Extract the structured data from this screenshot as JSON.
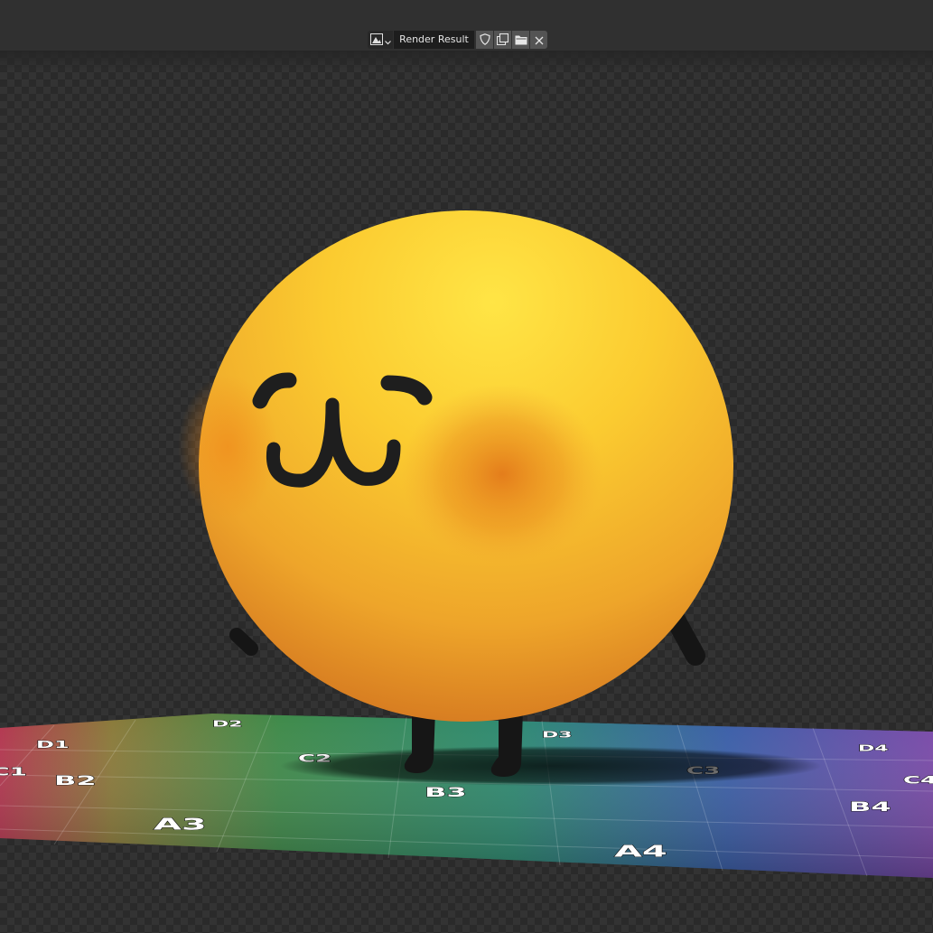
{
  "header": {
    "image_name": "Render Result",
    "icons": {
      "browse": "image-browse-icon",
      "fake_user": "shield-icon",
      "new": "duplicate-icon",
      "open": "folder-icon",
      "unlink": "close-icon"
    }
  },
  "render": {
    "subject": "yellow-ball-character",
    "floor_tile_labels": [
      {
        "text": "D1"
      },
      {
        "text": "D2"
      },
      {
        "text": "D3"
      },
      {
        "text": "D4"
      },
      {
        "text": "C1"
      },
      {
        "text": "C2"
      },
      {
        "text": "C3"
      },
      {
        "text": "C4"
      },
      {
        "text": "B2"
      },
      {
        "text": "B3"
      },
      {
        "text": "B4"
      },
      {
        "text": "A3"
      },
      {
        "text": "A4"
      }
    ]
  },
  "colors": {
    "header_bg": "#303030",
    "name_field_bg": "#1d1d1d",
    "button_bg": "#545454",
    "ball_light": "#ffe042",
    "ball_mid": "#f7b324",
    "ball_dark": "#d9781e",
    "cheek": "#e07c1e",
    "face_lines": "#1e1e1e"
  }
}
